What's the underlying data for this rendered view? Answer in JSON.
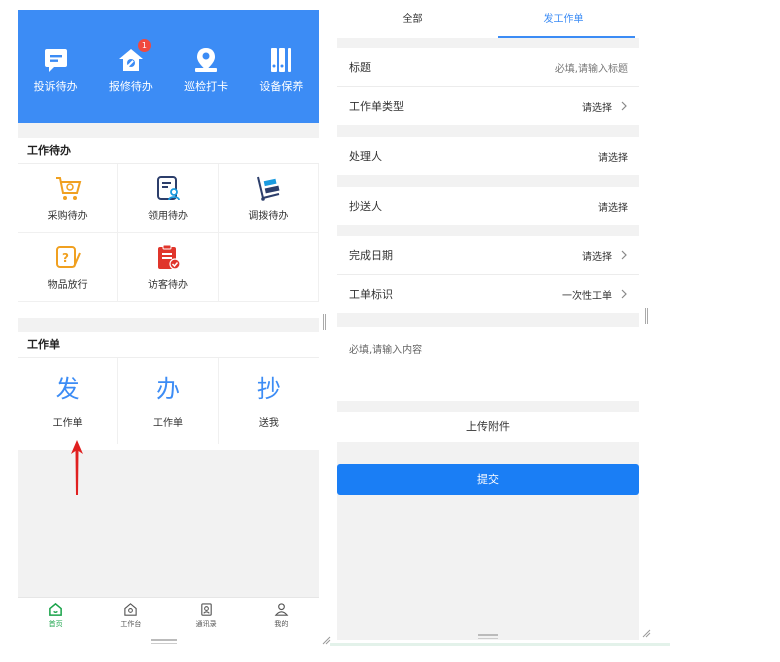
{
  "left": {
    "header_items": [
      {
        "label": "投诉待办",
        "icon": "chat-icon"
      },
      {
        "label": "报修待办",
        "icon": "repair-icon",
        "badge": "1"
      },
      {
        "label": "巡检打卡",
        "icon": "location-person-icon"
      },
      {
        "label": "设备保养",
        "icon": "device-icon"
      }
    ],
    "todo_section": {
      "title": "工作待办",
      "items": [
        {
          "label": "采购待办",
          "icon": "shopping-cart-icon"
        },
        {
          "label": "领用待办",
          "icon": "receive-form-icon"
        },
        {
          "label": "调拨待办",
          "icon": "transfer-cart-icon"
        },
        {
          "label": "物品放行",
          "icon": "item-release-icon"
        },
        {
          "label": "访客待办",
          "icon": "visitor-clipboard-icon"
        }
      ]
    },
    "workorder_section": {
      "title": "工作单",
      "items": [
        {
          "char": "发",
          "label": "工作单"
        },
        {
          "char": "办",
          "label": "工作单"
        },
        {
          "char": "抄",
          "label": "送我"
        }
      ]
    },
    "tabbar": [
      {
        "label": "首页",
        "icon": "home-icon",
        "active": true
      },
      {
        "label": "工作台",
        "icon": "workbench-icon",
        "active": false
      },
      {
        "label": "通讯录",
        "icon": "contacts-icon",
        "active": false
      },
      {
        "label": "我的",
        "icon": "user-icon",
        "active": false
      }
    ]
  },
  "right": {
    "tabs": [
      {
        "label": "全部",
        "active": false
      },
      {
        "label": "发工作单",
        "active": true
      }
    ],
    "rows": {
      "title": {
        "label": "标题",
        "value": "必填,请输入标题"
      },
      "type": {
        "label": "工作单类型",
        "value": "请选择"
      },
      "handler": {
        "label": "处理人",
        "value": "请选择"
      },
      "cc": {
        "label": "抄送人",
        "value": "请选择"
      },
      "due_date": {
        "label": "完成日期",
        "value": "请选择"
      },
      "flag": {
        "label": "工单标识",
        "value": "一次性工单"
      }
    },
    "content_placeholder": "必填,请输入内容",
    "upload_label": "上传附件",
    "submit_label": "提交"
  },
  "colors": {
    "primary_blue": "#3c8cf5",
    "submit_blue": "#1a7ef5",
    "badge_red": "#f04a3e",
    "icon_orange": "#f0a020",
    "icon_red": "#e0352b",
    "icon_navy": "#2c3e6b",
    "icon_teal": "#1a9be0",
    "active_green": "#1aa34a"
  }
}
